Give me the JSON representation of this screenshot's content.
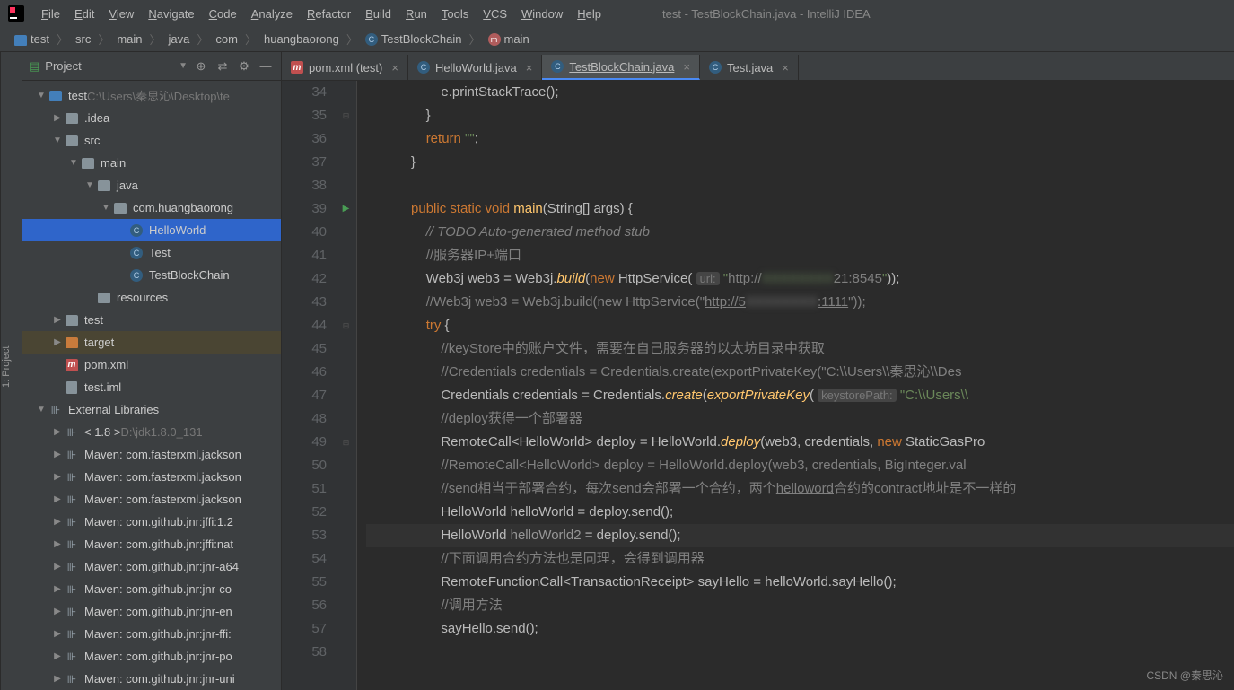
{
  "window_title": "test - TestBlockChain.java - IntelliJ IDEA",
  "menu": [
    "File",
    "Edit",
    "View",
    "Navigate",
    "Code",
    "Analyze",
    "Refactor",
    "Build",
    "Run",
    "Tools",
    "VCS",
    "Window",
    "Help"
  ],
  "breadcrumb": [
    {
      "label": "test",
      "icon": "folder"
    },
    {
      "label": "src"
    },
    {
      "label": "main"
    },
    {
      "label": "java"
    },
    {
      "label": "com"
    },
    {
      "label": "huangbaorong"
    },
    {
      "label": "TestBlockChain",
      "icon": "class"
    },
    {
      "label": "main",
      "icon": "method"
    }
  ],
  "project_header": {
    "title": "Project"
  },
  "tree": [
    {
      "depth": 0,
      "arrow": "▼",
      "icon": "folder-blue",
      "label": "test",
      "suffix": "C:\\Users\\秦思沁\\Desktop\\te"
    },
    {
      "depth": 1,
      "arrow": "▶",
      "icon": "folder",
      "label": ".idea"
    },
    {
      "depth": 1,
      "arrow": "▼",
      "icon": "folder",
      "label": "src"
    },
    {
      "depth": 2,
      "arrow": "▼",
      "icon": "folder",
      "label": "main"
    },
    {
      "depth": 3,
      "arrow": "▼",
      "icon": "folder",
      "label": "java"
    },
    {
      "depth": 4,
      "arrow": "▼",
      "icon": "folder",
      "label": "com.huangbaorong"
    },
    {
      "depth": 5,
      "arrow": "",
      "icon": "class",
      "label": "HelloWorld",
      "selected": true
    },
    {
      "depth": 5,
      "arrow": "",
      "icon": "class",
      "label": "Test"
    },
    {
      "depth": 5,
      "arrow": "",
      "icon": "class",
      "label": "TestBlockChain"
    },
    {
      "depth": 3,
      "arrow": "",
      "icon": "folder",
      "label": "resources"
    },
    {
      "depth": 1,
      "arrow": "▶",
      "icon": "folder",
      "label": "test"
    },
    {
      "depth": 1,
      "arrow": "▶",
      "icon": "folder-orange",
      "label": "target",
      "hl": true
    },
    {
      "depth": 1,
      "arrow": "",
      "icon": "m",
      "label": "pom.xml"
    },
    {
      "depth": 1,
      "arrow": "",
      "icon": "file",
      "label": "test.iml"
    },
    {
      "depth": 0,
      "arrow": "▼",
      "icon": "lib",
      "label": "External Libraries"
    },
    {
      "depth": 1,
      "arrow": "▶",
      "icon": "lib",
      "label": "< 1.8 >",
      "suffix": "D:\\jdk1.8.0_131"
    },
    {
      "depth": 1,
      "arrow": "▶",
      "icon": "lib",
      "label": "Maven: com.fasterxml.jackson"
    },
    {
      "depth": 1,
      "arrow": "▶",
      "icon": "lib",
      "label": "Maven: com.fasterxml.jackson"
    },
    {
      "depth": 1,
      "arrow": "▶",
      "icon": "lib",
      "label": "Maven: com.fasterxml.jackson"
    },
    {
      "depth": 1,
      "arrow": "▶",
      "icon": "lib",
      "label": "Maven: com.github.jnr:jffi:1.2"
    },
    {
      "depth": 1,
      "arrow": "▶",
      "icon": "lib",
      "label": "Maven: com.github.jnr:jffi:nat"
    },
    {
      "depth": 1,
      "arrow": "▶",
      "icon": "lib",
      "label": "Maven: com.github.jnr:jnr-a64"
    },
    {
      "depth": 1,
      "arrow": "▶",
      "icon": "lib",
      "label": "Maven: com.github.jnr:jnr-co"
    },
    {
      "depth": 1,
      "arrow": "▶",
      "icon": "lib",
      "label": "Maven: com.github.jnr:jnr-en"
    },
    {
      "depth": 1,
      "arrow": "▶",
      "icon": "lib",
      "label": "Maven: com.github.jnr:jnr-ffi:"
    },
    {
      "depth": 1,
      "arrow": "▶",
      "icon": "lib",
      "label": "Maven: com.github.jnr:jnr-po"
    },
    {
      "depth": 1,
      "arrow": "▶",
      "icon": "lib",
      "label": "Maven: com.github.jnr:jnr-uni"
    }
  ],
  "tabs": [
    {
      "label": "pom.xml (test)",
      "icon": "m",
      "active": false
    },
    {
      "label": "HelloWorld.java",
      "icon": "class",
      "active": false
    },
    {
      "label": "TestBlockChain.java",
      "icon": "class",
      "active": true
    },
    {
      "label": "Test.java",
      "icon": "class",
      "active": false
    }
  ],
  "code": {
    "first_line": 34,
    "caret_line": 53,
    "run_marker_line": 39,
    "lines": [
      {
        "n": 34,
        "html": "                    e.printStackTrace();"
      },
      {
        "n": 35,
        "html": "                }"
      },
      {
        "n": 36,
        "html": "                <span class='kw'>return </span><span class='str'>\"\"</span>;"
      },
      {
        "n": 37,
        "html": "            }"
      },
      {
        "n": 38,
        "html": ""
      },
      {
        "n": 39,
        "html": "            <span class='kw'>public static void </span><span class='method'>main</span>(String[] args) {"
      },
      {
        "n": 40,
        "html": "                <span class='com-it'>// TODO Auto-generated method stub</span>"
      },
      {
        "n": 41,
        "html": "                <span class='com'>//服务器IP+端口</span>"
      },
      {
        "n": 42,
        "html": "                Web3j web3 = Web3j.<span class='methodit'>build</span>(<span class='kw'>new </span>HttpService( <span class='hint'>url:</span> <span class='str'>\"<span class='url'>http://</span><span class='blur'>XXXXXXXX</span><span class='url'>21:8545</span>\"</span>));"
      },
      {
        "n": 43,
        "html": "                <span class='com'>//Web3j web3 = Web3j.build(new HttpService(\"<span class='url'>http://5</span><span class='blur'>XXXXXXXX</span><span class='url'>:1111</span>\"));</span>"
      },
      {
        "n": 44,
        "html": "                <span class='kw'>try </span>{"
      },
      {
        "n": 45,
        "html": "                    <span class='com'>//keyStore中的账户文件，需要在自己服务器的以太坊目录中获取</span>"
      },
      {
        "n": 46,
        "html": "                    <span class='com'>//Credentials credentials = Credentials.create(exportPrivateKey(\"C:\\\\Users\\\\秦思沁\\\\Des</span>"
      },
      {
        "n": 47,
        "html": "                    Credentials credentials = Credentials.<span class='methodit'>create</span>(<span class='methodit'>exportPrivateKey</span>( <span class='hint'>keystorePath:</span> <span class='str'>\"C:\\\\Users\\\\</span>"
      },
      {
        "n": 48,
        "html": "                    <span class='com'>//deploy获得一个部署器</span>"
      },
      {
        "n": 49,
        "html": "                    RemoteCall&lt;HelloWorld&gt; deploy = HelloWorld.<span class='methodit'>deploy</span>(web3, credentials, <span class='kw'>new </span>StaticGasPro"
      },
      {
        "n": 50,
        "html": "                    <span class='com'>//RemoteCall&lt;HelloWorld&gt; deploy = HelloWorld.deploy(web3, credentials, BigInteger.val</span>"
      },
      {
        "n": 51,
        "html": "                    <span class='com'>//send相当于部署合约，每次send会部署一个合约，两个<span class='url'>helloword</span>合约的contract地址是不一样的</span>"
      },
      {
        "n": 52,
        "html": "                    HelloWorld helloWorld = deploy.send();"
      },
      {
        "n": 53,
        "html": "                    HelloWorld <span style='color:#969696'>helloWorld2</span> = deploy.send();"
      },
      {
        "n": 54,
        "html": "                    <span class='com'>//下面调用合约方法也是同理，会得到调用器</span>"
      },
      {
        "n": 55,
        "html": "                    RemoteFunctionCall&lt;TransactionReceipt&gt; sayHello = helloWorld.sayHello();"
      },
      {
        "n": 56,
        "html": "                    <span class='com'>//调用方法</span>"
      },
      {
        "n": 57,
        "html": "                    sayHello.send();"
      },
      {
        "n": 58,
        "html": ""
      }
    ]
  },
  "watermark": "CSDN @秦思沁",
  "left_rail": "1: Project"
}
